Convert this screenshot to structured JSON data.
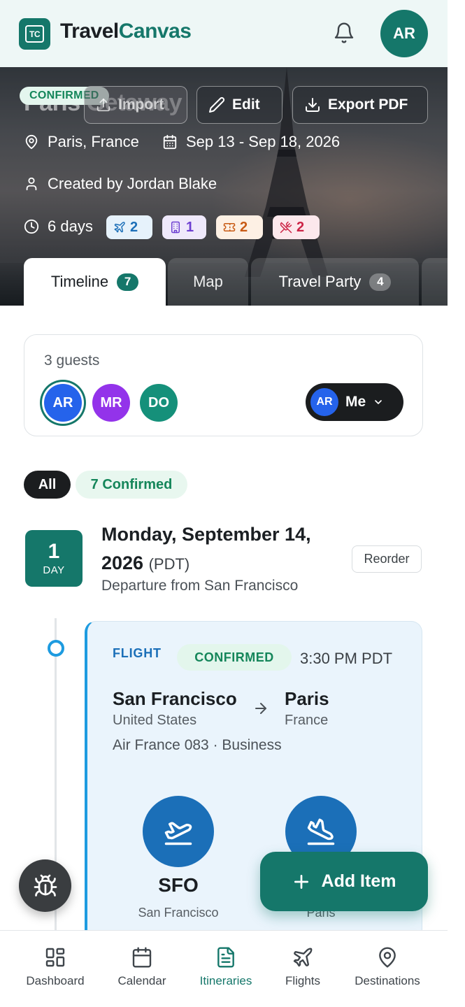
{
  "header": {
    "logo_text": "TC",
    "brand_part1": "Travel",
    "brand_part2": "Canvas",
    "user_initials": "AR"
  },
  "trip": {
    "title": "Paris Getaway",
    "status": "CONFIRMED",
    "actions": {
      "import": "Import",
      "edit": "Edit",
      "export": "Export PDF"
    },
    "location": "Paris, France",
    "dates": "Sep 13 - Sep 18, 2026",
    "creator": "Created by Jordan Blake",
    "duration": "6 days",
    "counts": {
      "flights": "2",
      "hotels": "1",
      "activities": "2",
      "dining": "2"
    }
  },
  "tabs": [
    {
      "label": "Timeline",
      "badge": "7"
    },
    {
      "label": "Map"
    },
    {
      "label": "Travel Party",
      "badge": "4"
    }
  ],
  "guests": {
    "count_label": "3 guests",
    "avatars": [
      "AR",
      "MR",
      "DO"
    ],
    "viewer": {
      "initials": "AR",
      "label": "Me"
    }
  },
  "filters": {
    "all": "All",
    "confirmed": "7 Confirmed"
  },
  "day": {
    "number": "1",
    "unit": "DAY",
    "date": "Monday, September 14, 2026",
    "timezone": "(PDT)",
    "subtitle": "Departure from San Francisco",
    "reorder_label": "Reorder"
  },
  "flight": {
    "type": "FLIGHT",
    "status": "CONFIRMED",
    "time": "3:30 PM PDT",
    "from_city": "San Francisco",
    "from_country": "United States",
    "to_city": "Paris",
    "to_country": "France",
    "airline": "Air France 083 · Business",
    "departure_code": "SFO",
    "departure_city": "San Francisco",
    "arrival_city": "Paris"
  },
  "fab": {
    "add_label": "Add Item"
  },
  "bottom_nav": [
    {
      "label": "Dashboard",
      "icon": "grid-icon"
    },
    {
      "label": "Calendar",
      "icon": "calendar-icon"
    },
    {
      "label": "Itineraries",
      "icon": "document-icon",
      "active": true
    },
    {
      "label": "Flights",
      "icon": "plane-icon"
    },
    {
      "label": "Destinations",
      "icon": "map-pin-icon"
    }
  ],
  "colors": {
    "brand": "#15776a",
    "flight_accent": "#1d9be0",
    "confirmed_text": "#15865a"
  }
}
